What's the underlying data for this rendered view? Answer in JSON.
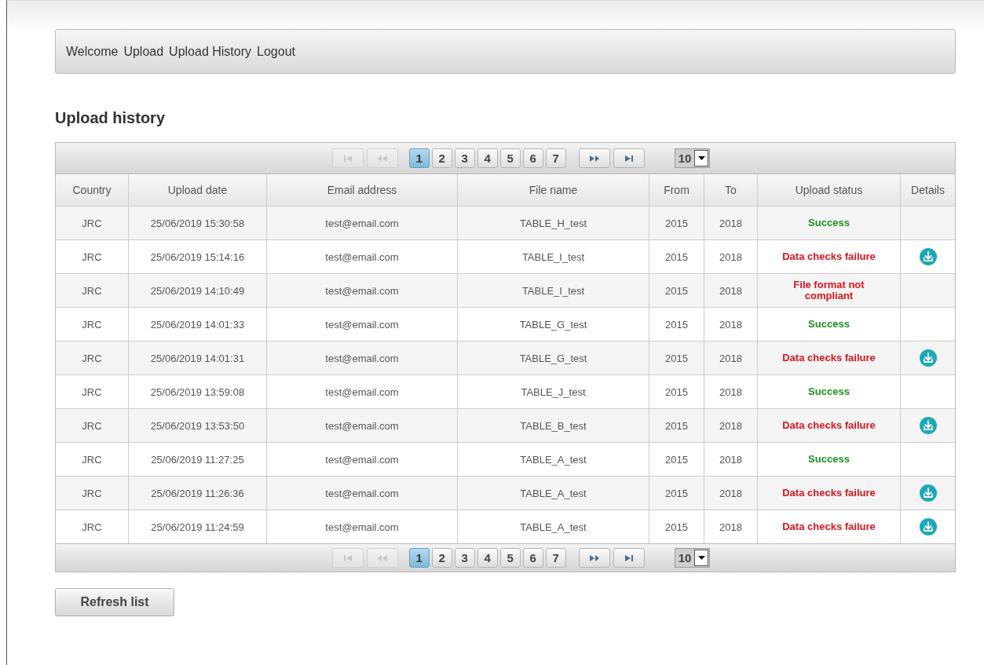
{
  "nav": [
    {
      "label": "Welcome"
    },
    {
      "label": "Upload"
    },
    {
      "label": "Upload History"
    },
    {
      "label": "Logout"
    }
  ],
  "title": "Upload history",
  "pager": {
    "first_disabled": true,
    "prev_disabled": true,
    "next_disabled": false,
    "last_disabled": false,
    "pages": [
      {
        "label": "1",
        "selected": true
      },
      {
        "label": "2",
        "selected": false
      },
      {
        "label": "3",
        "selected": false
      },
      {
        "label": "4",
        "selected": false
      },
      {
        "label": "5",
        "selected": false
      },
      {
        "label": "6",
        "selected": false
      },
      {
        "label": "7",
        "selected": false
      }
    ],
    "page_size": "10"
  },
  "table": {
    "columns": [
      "Country",
      "Upload date",
      "Email address",
      "File name",
      "From",
      "To",
      "Upload status",
      "Details"
    ],
    "rows": [
      {
        "country": "JRC",
        "date": "25/06/2019 15:30:58",
        "email": "test@email.com",
        "file": "TABLE_H_test",
        "from": "2015",
        "to": "2018",
        "status": "Success",
        "kind": "success",
        "download": false
      },
      {
        "country": "JRC",
        "date": "25/06/2019 15:14:16",
        "email": "test@email.com",
        "file": "TABLE_I_test",
        "from": "2015",
        "to": "2018",
        "status": "Data checks failure",
        "kind": "failure",
        "download": true
      },
      {
        "country": "JRC",
        "date": "25/06/2019 14:10:49",
        "email": "test@email.com",
        "file": "TABLE_I_test",
        "from": "2015",
        "to": "2018",
        "status": "File format not compliant",
        "kind": "failure",
        "download": false
      },
      {
        "country": "JRC",
        "date": "25/06/2019 14:01:33",
        "email": "test@email.com",
        "file": "TABLE_G_test",
        "from": "2015",
        "to": "2018",
        "status": "Success",
        "kind": "success",
        "download": false
      },
      {
        "country": "JRC",
        "date": "25/06/2019 14:01:31",
        "email": "test@email.com",
        "file": "TABLE_G_test",
        "from": "2015",
        "to": "2018",
        "status": "Data checks failure",
        "kind": "failure",
        "download": true
      },
      {
        "country": "JRC",
        "date": "25/06/2019 13:59:08",
        "email": "test@email.com",
        "file": "TABLE_J_test",
        "from": "2015",
        "to": "2018",
        "status": "Success",
        "kind": "success",
        "download": false
      },
      {
        "country": "JRC",
        "date": "25/06/2019 13:53:50",
        "email": "test@email.com",
        "file": "TABLE_B_test",
        "from": "2015",
        "to": "2018",
        "status": "Data checks failure",
        "kind": "failure",
        "download": true
      },
      {
        "country": "JRC",
        "date": "25/06/2019 11:27:25",
        "email": "test@email.com",
        "file": "TABLE_A_test",
        "from": "2015",
        "to": "2018",
        "status": "Success",
        "kind": "success",
        "download": false
      },
      {
        "country": "JRC",
        "date": "25/06/2019 11:26:36",
        "email": "test@email.com",
        "file": "TABLE_A_test",
        "from": "2015",
        "to": "2018",
        "status": "Data checks failure",
        "kind": "failure",
        "download": true
      },
      {
        "country": "JRC",
        "date": "25/06/2019 11:24:59",
        "email": "test@email.com",
        "file": "TABLE_A_test",
        "from": "2015",
        "to": "2018",
        "status": "Data checks failure",
        "kind": "failure",
        "download": true
      }
    ]
  },
  "bottom_pager": {
    "first_disabled": true,
    "prev_disabled": true,
    "next_disabled": false,
    "last_disabled": false,
    "pages": [
      {
        "label": "1",
        "selected": true
      },
      {
        "label": "2",
        "selected": false
      },
      {
        "label": "3",
        "selected": false
      },
      {
        "label": "4",
        "selected": false
      },
      {
        "label": "5",
        "selected": false
      },
      {
        "label": "6",
        "selected": false
      },
      {
        "label": "7",
        "selected": false
      }
    ],
    "page_size": "10"
  },
  "refresh_button": "Refresh list"
}
